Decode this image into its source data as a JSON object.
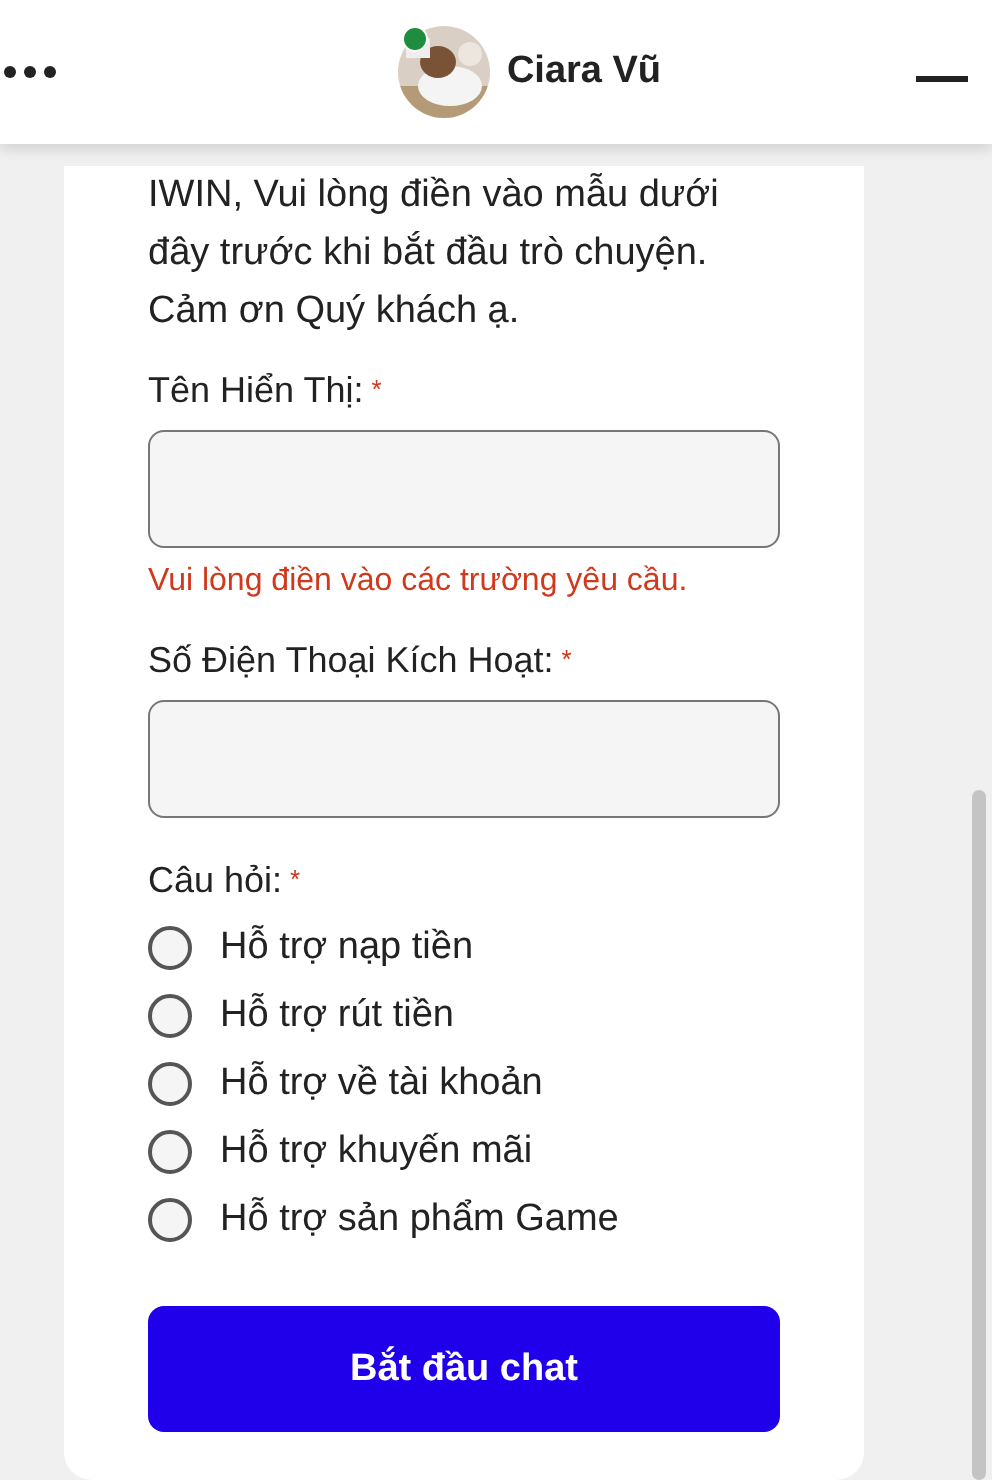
{
  "header": {
    "name": "Ciara Vũ",
    "online": true
  },
  "form": {
    "intro": "IWIN, Vui lòng điền vào mẫu dưới đây trước khi bắt đầu trò chuyện. Cảm ơn Quý khách ạ.",
    "fields": [
      {
        "label": "Tên Hiển Thị:",
        "required_mark": "*",
        "error": "Vui lòng điền vào các trường yêu cầu."
      },
      {
        "label": "Số Điện Thoại Kích Hoạt:",
        "required_mark": "*"
      }
    ],
    "question": {
      "label": "Câu hỏi:",
      "required_mark": "*",
      "options": [
        {
          "label": "Hỗ trợ nạp tiền",
          "selected": false
        },
        {
          "label": "Hỗ trợ rút tiền",
          "selected": false
        },
        {
          "label": "Hỗ trợ về tài khoản",
          "selected": false
        },
        {
          "label": "Hỗ trợ khuyến mãi",
          "selected": false
        },
        {
          "label": "Hỗ trợ sản phẩm Game",
          "selected": false
        }
      ]
    },
    "submit": "Bắt đầu chat"
  }
}
